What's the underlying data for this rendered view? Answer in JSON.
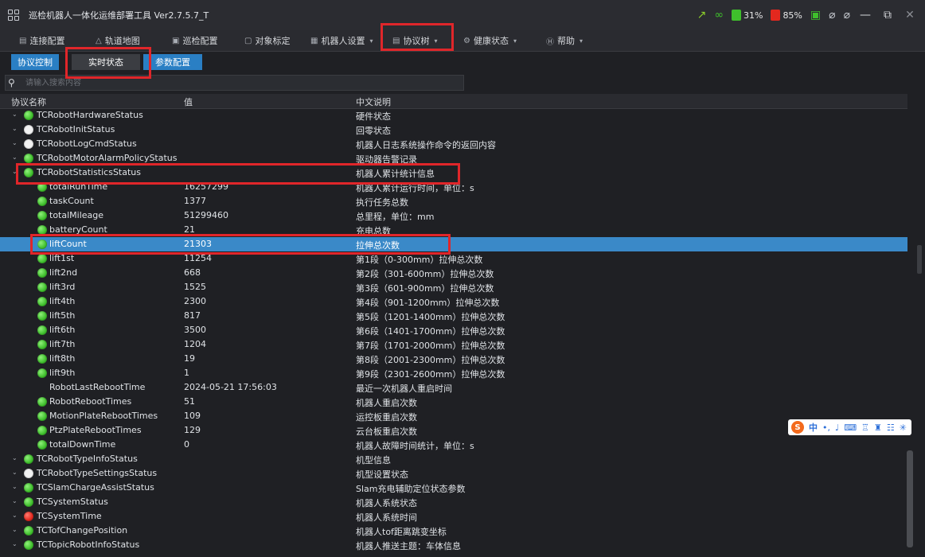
{
  "window": {
    "title": "巡检机器人一体化运维部署工具 Ver2.7.5.7_T",
    "icons": [
      "wifi-icon",
      "link-icon",
      "battery-icon",
      "battery-icon",
      "record-icon",
      "plug-icon",
      "plug-icon"
    ],
    "battery1_label": "31%",
    "battery2_label": "85%",
    "battery1_color": "#3fbf2c",
    "battery2_color": "#e3281e"
  },
  "menu": [
    {
      "label": "连接配置",
      "icon": "connect-icon",
      "has_caret": false
    },
    {
      "label": "轨道地图",
      "icon": "map-icon",
      "has_caret": false
    },
    {
      "label": "巡检配置",
      "icon": "inspect-icon",
      "has_caret": false
    },
    {
      "label": "对象标定",
      "icon": "target-icon",
      "has_caret": false
    },
    {
      "label": "机器人设置",
      "icon": "robot-icon",
      "has_caret": true
    },
    {
      "label": "协议树",
      "icon": "tree-icon",
      "has_caret": true
    },
    {
      "label": "健康状态",
      "icon": "health-icon",
      "has_caret": true
    },
    {
      "label": "帮助",
      "icon": "help-icon",
      "has_caret": true
    }
  ],
  "tabs": [
    {
      "label": "协议控制",
      "active": false
    },
    {
      "label": "实时状态",
      "active": true
    },
    {
      "label": "参数配置",
      "active": false
    }
  ],
  "search": {
    "placeholder": "请输入搜索内容"
  },
  "columns": {
    "name": "协议名称",
    "value": "值",
    "desc": "中文说明"
  },
  "rows": [
    {
      "level": 0,
      "status": "green",
      "name": "TCRobotHardwareStatus",
      "value": "",
      "desc": "硬件状态"
    },
    {
      "level": 0,
      "status": "white",
      "name": "TCRobotInitStatus",
      "value": "",
      "desc": "回零状态"
    },
    {
      "level": 0,
      "status": "white",
      "name": "TCRobotLogCmdStatus",
      "value": "",
      "desc": "机器人日志系统操作命令的返回内容"
    },
    {
      "level": 0,
      "status": "green",
      "name": "TCRobotMotorAlarmPolicyStatus",
      "value": "",
      "desc": "驱动器告警记录"
    },
    {
      "level": 0,
      "status": "green",
      "name": "TCRobotStatisticsStatus",
      "value": "",
      "desc": "机器人累计统计信息"
    },
    {
      "level": 1,
      "status": "green",
      "name": "totalRunTime",
      "value": "16257299",
      "desc": "机器人累计运行时间，单位：s"
    },
    {
      "level": 1,
      "status": "green",
      "name": "taskCount",
      "value": "1377",
      "desc": "执行任务总数"
    },
    {
      "level": 1,
      "status": "green",
      "name": "totalMileage",
      "value": "51299460",
      "desc": "总里程，单位：mm"
    },
    {
      "level": 1,
      "status": "green",
      "name": "batteryCount",
      "value": "21",
      "desc": "充电总数"
    },
    {
      "level": 1,
      "status": "green",
      "name": "liftCount",
      "value": "21303",
      "desc": "拉伸总次数",
      "selected": true
    },
    {
      "level": 1,
      "status": "green",
      "name": "lift1st",
      "value": "11254",
      "desc": "第1段（0-300mm）拉伸总次数"
    },
    {
      "level": 1,
      "status": "green",
      "name": "lift2nd",
      "value": "668",
      "desc": "第2段（301-600mm）拉伸总次数"
    },
    {
      "level": 1,
      "status": "green",
      "name": "lift3rd",
      "value": "1525",
      "desc": "第3段（601-900mm）拉伸总次数"
    },
    {
      "level": 1,
      "status": "green",
      "name": "lift4th",
      "value": "2300",
      "desc": "第4段（901-1200mm）拉伸总次数"
    },
    {
      "level": 1,
      "status": "green",
      "name": "lift5th",
      "value": "817",
      "desc": "第5段（1201-1400mm）拉伸总次数"
    },
    {
      "level": 1,
      "status": "green",
      "name": "lift6th",
      "value": "3500",
      "desc": "第6段（1401-1700mm）拉伸总次数"
    },
    {
      "level": 1,
      "status": "green",
      "name": "lift7th",
      "value": "1204",
      "desc": "第7段（1701-2000mm）拉伸总次数"
    },
    {
      "level": 1,
      "status": "green",
      "name": "lift8th",
      "value": "19",
      "desc": "第8段（2001-2300mm）拉伸总次数"
    },
    {
      "level": 1,
      "status": "green",
      "name": "lift9th",
      "value": "1",
      "desc": "第9段（2301-2600mm）拉伸总次数"
    },
    {
      "level": 1,
      "status": "none",
      "name": "RobotLastRebootTime",
      "value": "2024-05-21 17:56:03",
      "desc": "最近一次机器人重启时间"
    },
    {
      "level": 1,
      "status": "green",
      "name": "RobotRebootTimes",
      "value": "51",
      "desc": "机器人重启次数"
    },
    {
      "level": 1,
      "status": "green",
      "name": "MotionPlateRebootTimes",
      "value": "109",
      "desc": "运控板重启次数"
    },
    {
      "level": 1,
      "status": "green",
      "name": "PtzPlateRebootTimes",
      "value": "129",
      "desc": "云台板重启次数"
    },
    {
      "level": 1,
      "status": "green",
      "name": "totalDownTime",
      "value": "0",
      "desc": "机器人故障时间统计，单位：s"
    },
    {
      "level": 0,
      "status": "green",
      "name": "TCRobotTypeInfoStatus",
      "value": "",
      "desc": "机型信息"
    },
    {
      "level": 0,
      "status": "white",
      "name": "TCRobotTypeSettingsStatus",
      "value": "",
      "desc": "机型设置状态"
    },
    {
      "level": 0,
      "status": "green",
      "name": "TCSlamChargeAssistStatus",
      "value": "",
      "desc": "Slam充电辅助定位状态参数"
    },
    {
      "level": 0,
      "status": "green",
      "name": "TCSystemStatus",
      "value": "",
      "desc": "机器人系统状态"
    },
    {
      "level": 0,
      "status": "red",
      "name": "TCSystemTime",
      "value": "",
      "desc": "机器人系统时间"
    },
    {
      "level": 0,
      "status": "green",
      "name": "TCTofChangePosition",
      "value": "",
      "desc": "机器人tof距离跳变坐标"
    },
    {
      "level": 0,
      "status": "green",
      "name": "TCTopicRobotInfoStatus",
      "value": "",
      "desc": "机器人推送主题：车体信息"
    }
  ],
  "ime": {
    "logo": "S",
    "lang": "中",
    "icons": [
      "punct-icon",
      "mic-icon",
      "keyboard-icon",
      "shirt-icon",
      "game-icon",
      "grid-icon",
      "settings-icon"
    ]
  }
}
